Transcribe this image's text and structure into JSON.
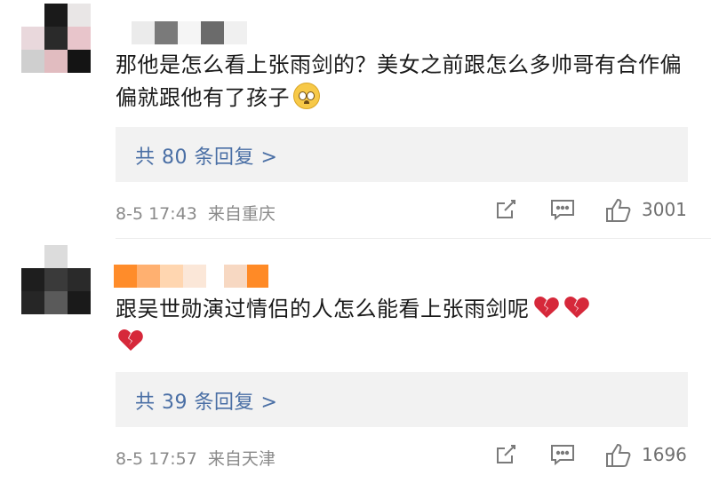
{
  "comments": [
    {
      "text": "那他是怎么看上张雨剑的？美女之前跟怎么多帅哥有合作偏偏就跟他有了孩子",
      "emoji": "flushed-face",
      "reply_link": "共 80 条回复 >",
      "date": "8-5 17:43",
      "location": "来自重庆",
      "likes": "3001"
    },
    {
      "text": "跟吴世勋演过情侣的人怎么能看上张雨剑呢",
      "emoji": "broken-heart",
      "reply_link": "共 39 条回复 >",
      "date": "8-5 17:57",
      "location": "来自天津",
      "likes": "1696"
    }
  ],
  "colors": {
    "link": "#4a6fa5",
    "meta": "#8a8a8a",
    "reply_bg": "#f2f2f2",
    "username_mosaic_2": "#ff8c2a"
  }
}
